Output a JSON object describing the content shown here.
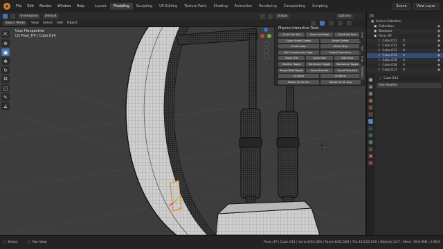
{
  "topbar": {
    "menus": [
      "File",
      "Edit",
      "Render",
      "Window",
      "Help"
    ],
    "workspaces": [
      "Layout",
      "Modeling",
      "Sculpting",
      "UV Editing",
      "Texture Paint",
      "Shading",
      "Animation",
      "Rendering",
      "Compositing",
      "Scripting"
    ],
    "active_workspace": "Modeling",
    "scene": "Scene",
    "view_layer": "View Layer"
  },
  "header": {
    "transform_label": "Orientation",
    "transform_value": "Global",
    "pivot_value": "Default",
    "mode": "Object Mode",
    "menus": [
      "View",
      "Select",
      "Add",
      "Object"
    ],
    "options": "Options"
  },
  "viewport": {
    "view_name": "User Perspective",
    "object_info": "(2) Pose_HP | Cube.014"
  },
  "panel": {
    "title": "Physics Interactive Tools",
    "rows": [
      [
        "Quick Set Add",
        "Quick Set Edge",
        "Quick Set Face"
      ],
      [
        "Super Smart Create",
        "Smart Delete"
      ],
      [
        "Smart Loop",
        "Smart Ring"
      ],
      [
        "Set Curvature by Edge",
        "Radial Symmetry"
      ],
      [
        "Quick FFD",
        "Quick Pipe",
        "Edit Pivot"
      ],
      [
        "Modifier Toggle",
        "Wireframe Toggle",
        "Workplane Toggle"
      ],
      [
        "Target Weld Toggle",
        "Smart Extrude",
        "Smart Translate"
      ],
      [
        "CS Bevel",
        "CS Bevel"
      ],
      [
        "Rotate UV 90 Pos",
        "Rotate UV 90 Neg"
      ]
    ]
  },
  "side_tabs": [
    "Item",
    "Tool",
    "View",
    "HardOps"
  ],
  "outliner": {
    "title": "Scene Collection",
    "rows": [
      {
        "name": "Collection",
        "indent": 1
      },
      {
        "name": "Blockout",
        "indent": 1
      },
      {
        "name": "Pose_HP",
        "indent": 1
      },
      {
        "name": "Cube.011",
        "indent": 2
      },
      {
        "name": "Cube.012",
        "indent": 2
      },
      {
        "name": "Cube.013",
        "indent": 2
      },
      {
        "name": "Cube.014",
        "indent": 2
      },
      {
        "name": "Cube.015",
        "indent": 2
      },
      {
        "name": "Cube.016",
        "indent": 2
      },
      {
        "name": "Cube.017",
        "indent": 2
      }
    ]
  },
  "properties": {
    "object": "Cube.014",
    "add_modifier": "Add Modifier"
  },
  "statusbar": {
    "left": "Select",
    "mid": "Pan View",
    "right": "Pose_HP | Cube.014 | Verts:8/63,360 | Faces:6/62,508 | Tris:12/125,016 | Objects:1/17 | Mem: 19.8 MiB | 2.90.0"
  },
  "colors": {
    "accent": "#4772b3",
    "orange": "#e87d0d",
    "viewport_bg": "#3d3d3d"
  }
}
